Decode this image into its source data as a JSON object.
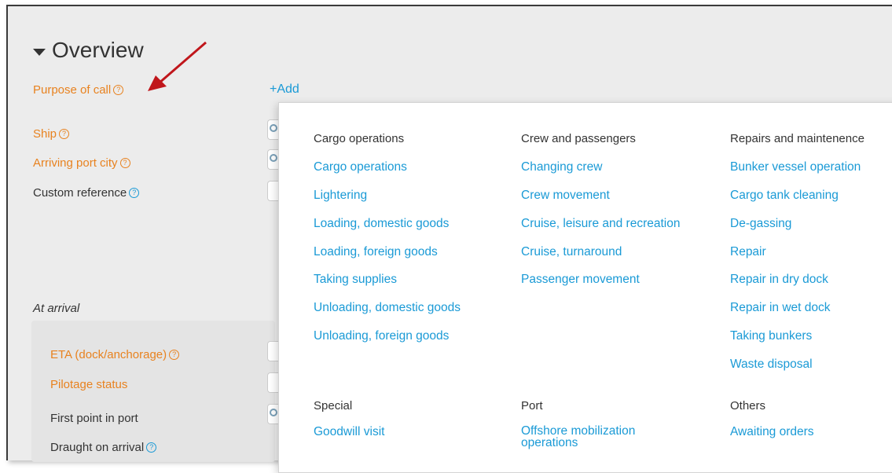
{
  "overview": {
    "title": "Overview",
    "add_label": "+Add",
    "labels": {
      "purpose": "Purpose of call",
      "ship": "Ship",
      "arriving_port": "Arriving port city",
      "custom_reference": "Custom reference",
      "at_arrival": "At arrival",
      "eta": "ETA (dock/anchorage)",
      "pilotage": "Pilotage status",
      "first_point": "First point in port",
      "draught": "Draught on arrival"
    }
  },
  "dropdown": {
    "columns": [
      {
        "heading": "Cargo operations",
        "items": [
          "Cargo operations",
          "Lightering",
          "Loading, domestic goods",
          "Loading, foreign goods",
          "Taking supplies",
          "Unloading, domestic goods",
          "Unloading, foreign goods"
        ]
      },
      {
        "heading": "Crew and passengers",
        "items": [
          "Changing crew",
          "Crew movement",
          "Cruise, leisure and recreation",
          "Cruise, turnaround",
          "Passenger movement"
        ]
      },
      {
        "heading": "Repairs and maintenence",
        "items": [
          "Bunker vessel operation",
          "Cargo tank cleaning",
          "De-gassing",
          "Repair",
          "Repair in dry dock",
          "Repair in wet dock",
          "Taking bunkers",
          "Waste disposal"
        ]
      }
    ],
    "bottom": [
      {
        "heading": "Special",
        "items": [
          "Goodwill visit"
        ]
      },
      {
        "heading": "Port",
        "items": [
          "Offshore mobilization operations"
        ]
      },
      {
        "heading": "Others",
        "items": [
          "Awaiting orders"
        ]
      }
    ]
  },
  "colors": {
    "required": "#e8821f",
    "link": "#1a9ad6",
    "annotation_arrow": "#c0161b"
  }
}
